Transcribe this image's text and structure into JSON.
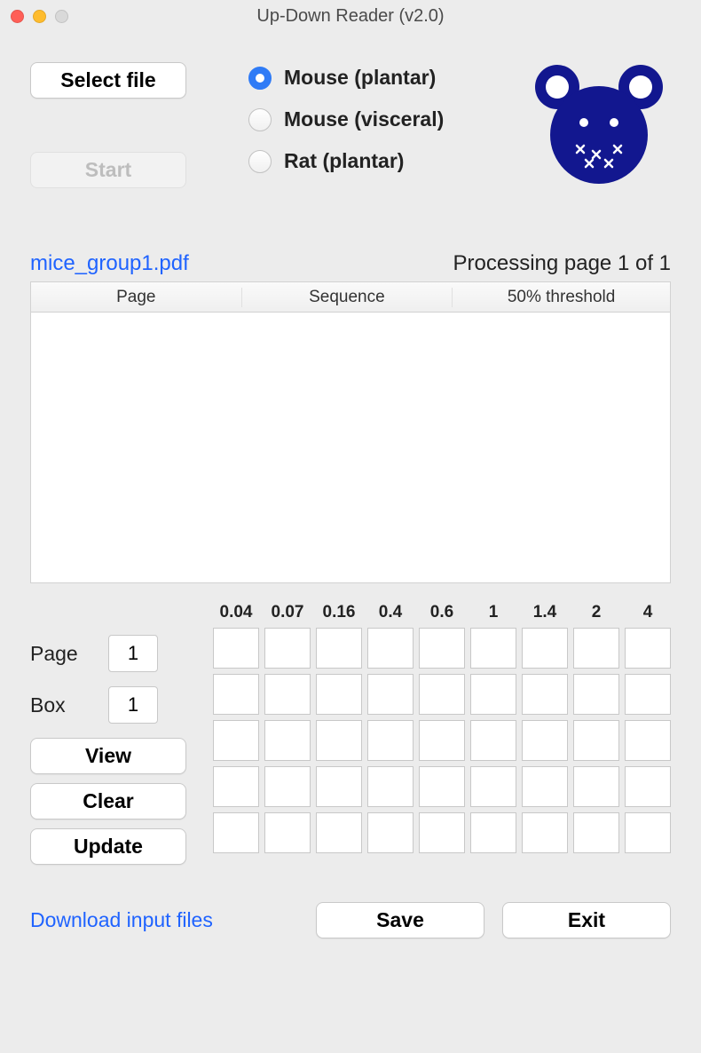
{
  "window": {
    "title": "Up-Down Reader (v2.0)"
  },
  "top": {
    "select_file": "Select file",
    "start": "Start"
  },
  "radios": {
    "options": [
      {
        "label": "Mouse (plantar)",
        "checked": true
      },
      {
        "label": "Mouse (visceral)",
        "checked": false
      },
      {
        "label": "Rat (plantar)",
        "checked": false
      }
    ]
  },
  "file": {
    "name": "mice_group1.pdf",
    "status": "Processing page 1 of 1"
  },
  "table": {
    "headers": [
      "Page",
      "Sequence",
      "50% threshold"
    ]
  },
  "controls": {
    "page_label": "Page",
    "page_value": "1",
    "box_label": "Box",
    "box_value": "1",
    "view": "View",
    "clear": "Clear",
    "update": "Update"
  },
  "grid": {
    "headers": [
      "0.04",
      "0.07",
      "0.16",
      "0.4",
      "0.6",
      "1",
      "1.4",
      "2",
      "4"
    ],
    "rows": 5
  },
  "footer": {
    "download": "Download input files",
    "save": "Save",
    "exit": "Exit"
  },
  "colors": {
    "accent": "#1f63ff",
    "logo": "#12178f"
  }
}
